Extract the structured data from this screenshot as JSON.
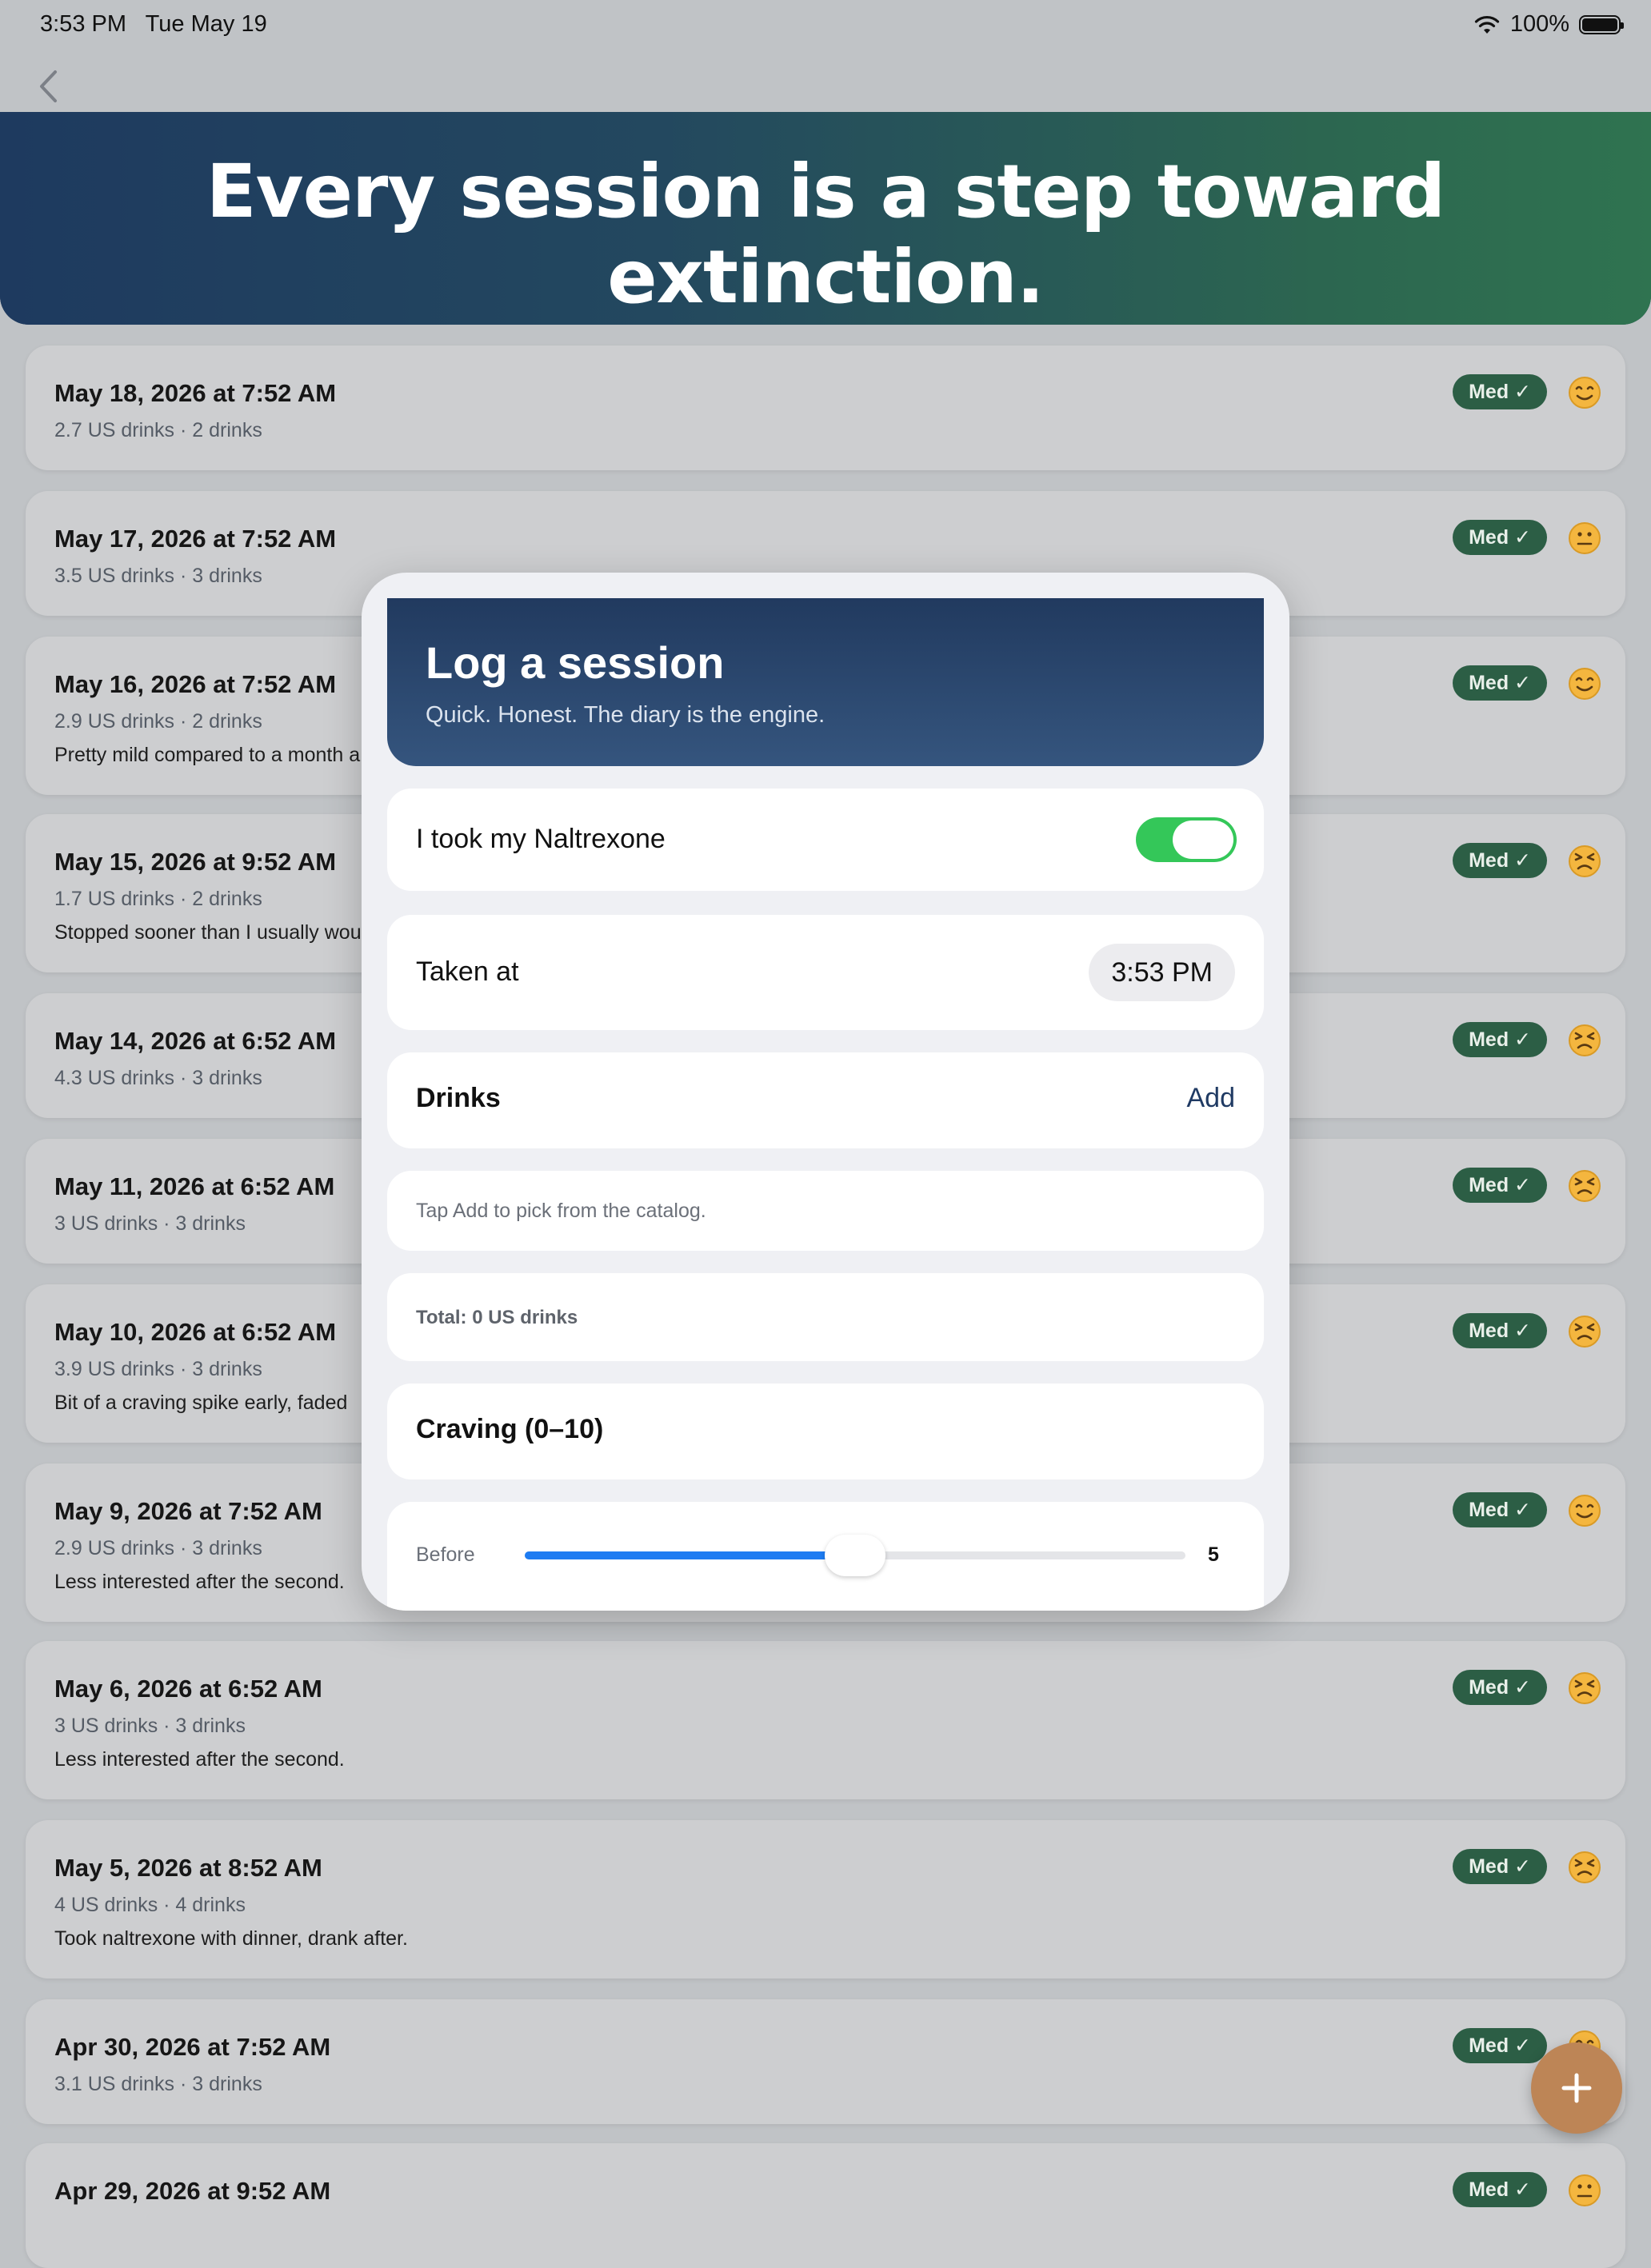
{
  "status_bar": {
    "time": "3:53 PM   Tue May 19",
    "battery_percent": "100%"
  },
  "banner": {
    "title": "Every session is a step toward extinction."
  },
  "sessions": [
    {
      "date": "May 18, 2026 at 7:52 AM",
      "summary": "2.7 US drinks · 2 drinks",
      "note": "",
      "badge": "Med ✓",
      "mood": "smiling"
    },
    {
      "date": "May 17, 2026 at 7:52 AM",
      "summary": "3.5 US drinks · 3 drinks",
      "note": "",
      "badge": "Med ✓",
      "mood": "neutral"
    },
    {
      "date": "May 16, 2026 at 7:52 AM",
      "summary": "2.9 US drinks · 2 drinks",
      "note": "Pretty mild compared to a month a",
      "badge": "Med ✓",
      "mood": "smiling"
    },
    {
      "date": "May 15, 2026 at 9:52 AM",
      "summary": "1.7 US drinks · 2 drinks",
      "note": "Stopped sooner than I usually wou",
      "badge": "Med ✓",
      "mood": "persevering"
    },
    {
      "date": "May 14, 2026 at 6:52 AM",
      "summary": "4.3 US drinks · 3 drinks",
      "note": "",
      "badge": "Med ✓",
      "mood": "persevering"
    },
    {
      "date": "May 11, 2026 at 6:52 AM",
      "summary": "3 US drinks · 3 drinks",
      "note": "",
      "badge": "Med ✓",
      "mood": "persevering"
    },
    {
      "date": "May 10, 2026 at 6:52 AM",
      "summary": "3.9 US drinks · 3 drinks",
      "note": "Bit of a craving spike early, faded",
      "badge": "Med ✓",
      "mood": "persevering"
    },
    {
      "date": "May 9, 2026 at 7:52 AM",
      "summary": "2.9 US drinks · 3 drinks",
      "note": "Less interested after the second.",
      "badge": "Med ✓",
      "mood": "smiling"
    },
    {
      "date": "May 6, 2026 at 6:52 AM",
      "summary": "3 US drinks · 3 drinks",
      "note": "Less interested after the second.",
      "badge": "Med ✓",
      "mood": "persevering"
    },
    {
      "date": "May 5, 2026 at 8:52 AM",
      "summary": "4 US drinks · 4 drinks",
      "note": "Took naltrexone with dinner, drank after.",
      "badge": "Med ✓",
      "mood": "persevering"
    },
    {
      "date": "Apr 30, 2026 at 7:52 AM",
      "summary": "3.1 US drinks · 3 drinks",
      "note": "",
      "badge": "Med ✓",
      "mood": "smiling"
    },
    {
      "date": "Apr 29, 2026 at 9:52 AM",
      "summary": "",
      "note": "",
      "badge": "Med ✓",
      "mood": "neutral"
    }
  ],
  "modal": {
    "title": "Log a session",
    "subtitle": "Quick. Honest. The diary is the engine.",
    "med_toggle": {
      "label": "I took my Naltrexone",
      "on": true
    },
    "taken_at": {
      "label": "Taken at",
      "value": "3:53 PM"
    },
    "drinks": {
      "label": "Drinks",
      "add_label": "Add",
      "empty_hint": "Tap Add to pick from the catalog.",
      "total": "Total: 0 US drinks"
    },
    "craving": {
      "label": "Craving (0–10)",
      "before": {
        "label": "Before",
        "value": 5,
        "value_text": "5",
        "min": 0,
        "max": 10
      }
    }
  },
  "colors": {
    "accent": "#1e7cf2",
    "toggle_on": "#34c759",
    "badge": "#2c5e45",
    "header": "#213a5f",
    "fab": "#bd8556"
  }
}
